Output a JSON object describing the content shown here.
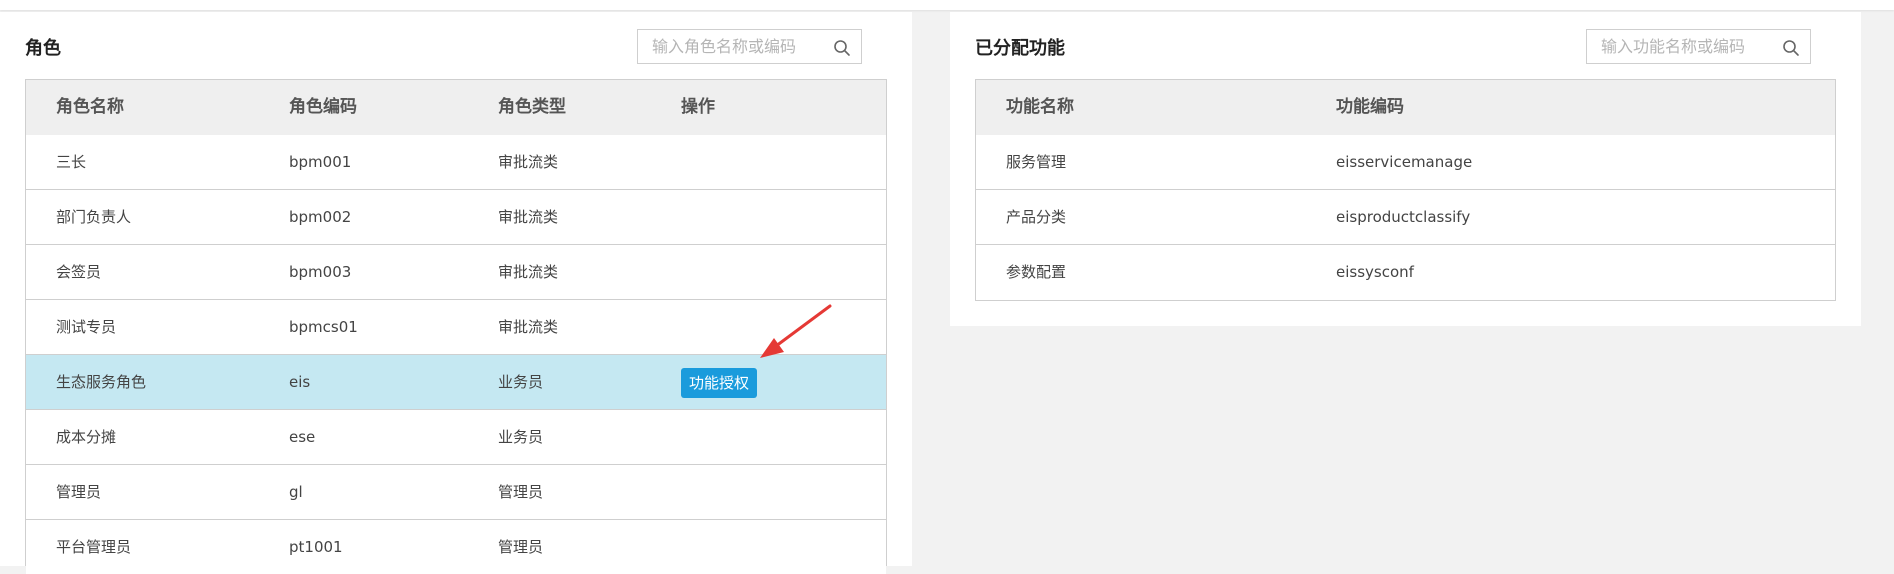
{
  "roles": {
    "title": "角色",
    "search_placeholder": "输入角色名称或编码",
    "columns": [
      "角色名称",
      "角色编码",
      "角色类型",
      "操作"
    ],
    "rows": [
      {
        "name": "三长",
        "code": "bpm001",
        "type": "审批流类"
      },
      {
        "name": "部门负责人",
        "code": "bpm002",
        "type": "审批流类"
      },
      {
        "name": "会签员",
        "code": "bpm003",
        "type": "审批流类"
      },
      {
        "name": "测试专员",
        "code": "bpmcs01",
        "type": "审批流类"
      },
      {
        "name": "生态服务角色",
        "code": "eis",
        "type": "业务员",
        "action": "功能授权",
        "selected": true
      },
      {
        "name": "成本分摊",
        "code": "ese",
        "type": "业务员"
      },
      {
        "name": "管理员",
        "code": "gl",
        "type": "管理员"
      },
      {
        "name": "平台管理员",
        "code": "pt1001",
        "type": "管理员"
      }
    ]
  },
  "functions": {
    "title": "已分配功能",
    "search_placeholder": "输入功能名称或编码",
    "columns": [
      "功能名称",
      "功能编码"
    ],
    "rows": [
      {
        "name": "服务管理",
        "code": "eisservicemanage"
      },
      {
        "name": "产品分类",
        "code": "eisproductclassify"
      },
      {
        "name": "参数配置",
        "code": "eissysconf"
      }
    ]
  },
  "colors": {
    "selected_row": "#c5e8f2",
    "action_button": "#1a9bdc",
    "annotation_arrow": "#e53935"
  },
  "icons": {
    "search": "magnifier-icon",
    "annotation": "red-arrow-icon"
  }
}
